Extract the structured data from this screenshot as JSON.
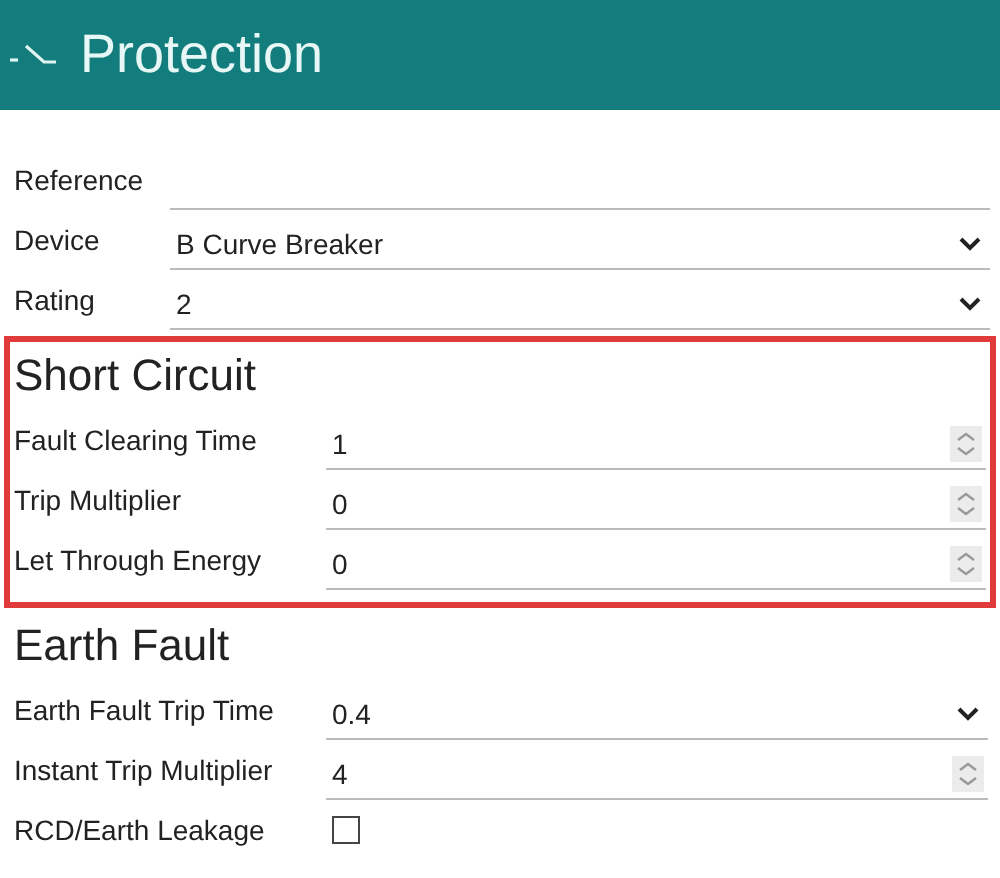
{
  "header": {
    "title": "Protection"
  },
  "fields": [
    {
      "label": "Reference",
      "kind": "text"
    },
    {
      "label": "Device",
      "kind": "dropdown",
      "value": "B Curve Breaker"
    },
    {
      "label": "Rating",
      "kind": "dropdown",
      "value": "2"
    }
  ],
  "sections": [
    {
      "title": "Short Circuit",
      "highlighted": true,
      "fields": [
        {
          "label": "Fault Clearing Time",
          "kind": "spinner",
          "value": "1"
        },
        {
          "label": "Trip Multiplier",
          "kind": "spinner",
          "value": "0"
        },
        {
          "label": "Let Through Energy",
          "kind": "spinner",
          "value": "0"
        }
      ]
    },
    {
      "title": "Earth Fault",
      "highlighted": false,
      "fields": [
        {
          "label": "Earth Fault Trip Time",
          "kind": "dropdown",
          "value": "0.4"
        },
        {
          "label": "Instant Trip Multiplier",
          "kind": "spinner",
          "value": "4"
        },
        {
          "label": "RCD/Earth Leakage",
          "kind": "checkbox",
          "checked": false
        }
      ]
    }
  ]
}
